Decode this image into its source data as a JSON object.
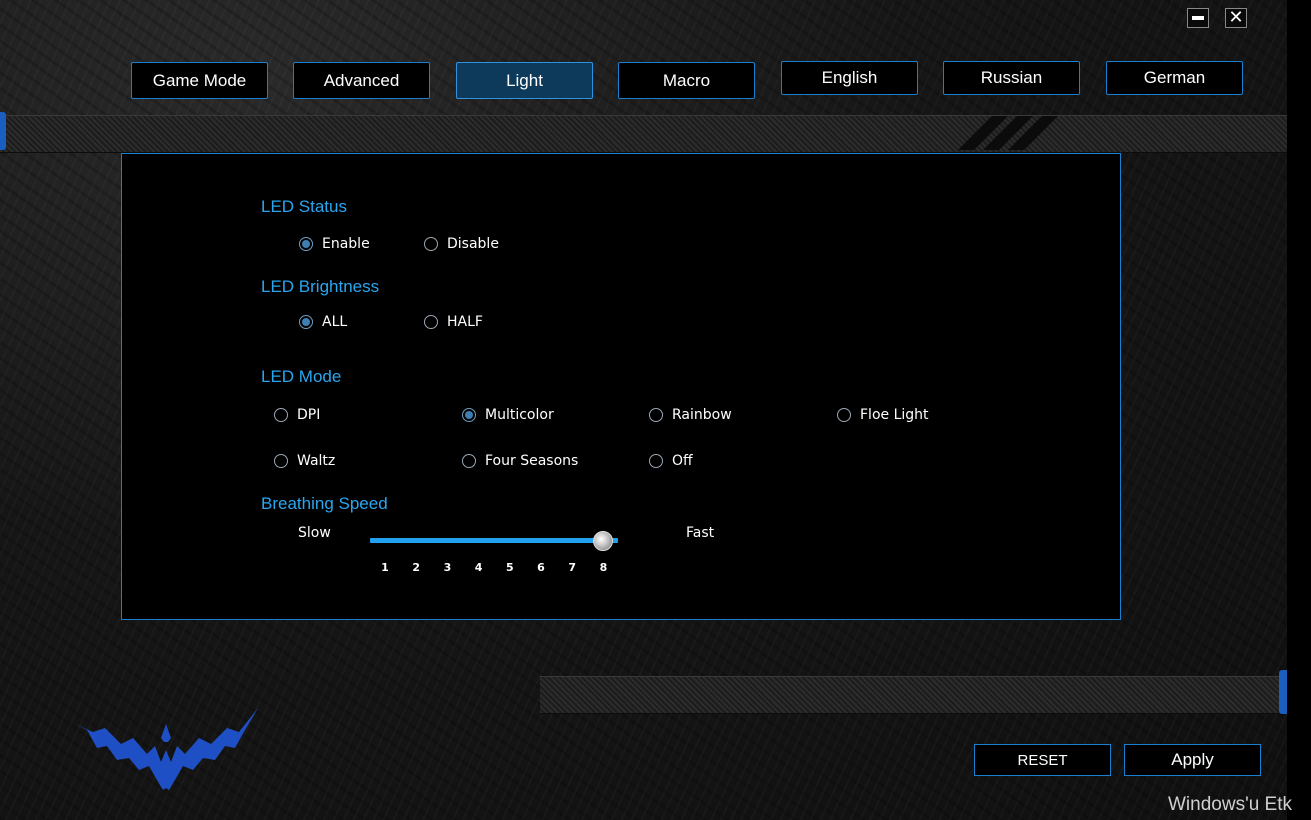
{
  "window": {
    "minimize_icon": "minimize-icon",
    "close_icon": "close-icon",
    "close_glyph": "✕"
  },
  "tabs": [
    {
      "label": "Game Mode",
      "active": false
    },
    {
      "label": "Advanced",
      "active": false
    },
    {
      "label": "Light",
      "active": true
    },
    {
      "label": "Macro",
      "active": false
    },
    {
      "label": "English",
      "active": false
    },
    {
      "label": "Russian",
      "active": false
    },
    {
      "label": "German",
      "active": false
    }
  ],
  "led_status": {
    "title": "LED Status",
    "options": [
      {
        "label": "Enable",
        "checked": true
      },
      {
        "label": "Disable",
        "checked": false
      }
    ]
  },
  "led_brightness": {
    "title": "LED Brightness",
    "options": [
      {
        "label": "ALL",
        "checked": true
      },
      {
        "label": "HALF",
        "checked": false
      }
    ]
  },
  "led_mode": {
    "title": "LED Mode",
    "options": [
      {
        "label": "DPI",
        "checked": false
      },
      {
        "label": "Multicolor",
        "checked": true
      },
      {
        "label": "Rainbow",
        "checked": false
      },
      {
        "label": "Floe Light",
        "checked": false
      },
      {
        "label": "Waltz",
        "checked": false
      },
      {
        "label": "Four Seasons",
        "checked": false
      },
      {
        "label": "Off",
        "checked": false
      }
    ]
  },
  "breathing_speed": {
    "title": "Breathing Speed",
    "min_label": "Slow",
    "max_label": "Fast",
    "ticks": [
      "1",
      "2",
      "3",
      "4",
      "5",
      "6",
      "7",
      "8"
    ],
    "value": 8
  },
  "actions": {
    "reset_label": "RESET",
    "apply_label": "Apply"
  },
  "logo_icon": "eagle-logo-icon",
  "watermark": "Windows'u Etk",
  "colors": {
    "accent": "#1b7fd0",
    "title": "#2aa6f0",
    "active_tab": "#0d3a5a",
    "logo": "#1f4fc4"
  }
}
